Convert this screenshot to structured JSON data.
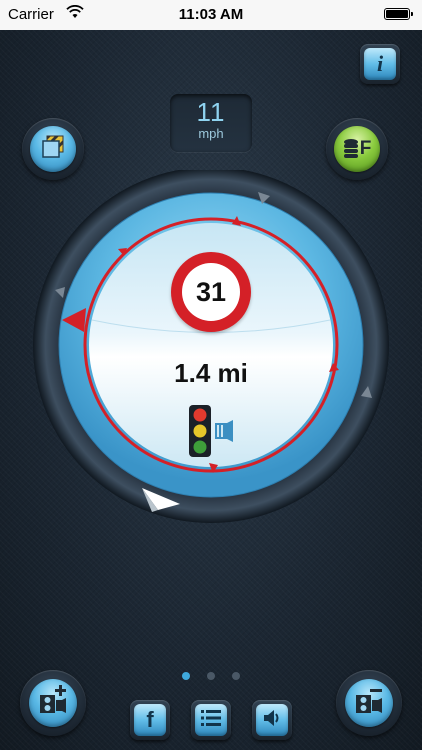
{
  "status_bar": {
    "carrier": "Carrier",
    "time": "11:03 AM",
    "battery_level": 1.0
  },
  "speed": {
    "value": "11",
    "unit": "mph"
  },
  "radar": {
    "speed_limit": "31",
    "distance": "1.4 mi",
    "camera_type_icon": "traffic-light-camera-icon"
  },
  "buttons": {
    "info": "i",
    "layers_icon": "layers-icon",
    "database_letter": "F",
    "facebook_letter": "f"
  },
  "pager": {
    "count": 3,
    "active": 0
  },
  "colors": {
    "accent_blue": "#5ab9e6",
    "alert_red": "#d42027",
    "green": "#8acb3e",
    "background": "#1c2733"
  }
}
